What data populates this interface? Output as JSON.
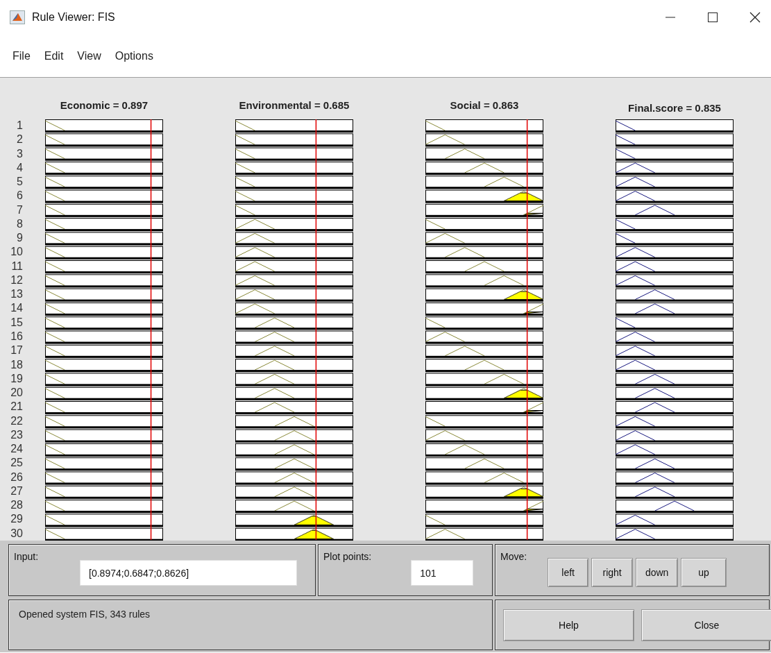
{
  "window": {
    "title": "Rule Viewer: FIS"
  },
  "menu": [
    "File",
    "Edit",
    "View",
    "Options"
  ],
  "columns": [
    {
      "title": "Economic = 0.897",
      "kind": "input"
    },
    {
      "title": "Environmental = 0.685",
      "kind": "input"
    },
    {
      "title": "Social = 0.863",
      "kind": "input"
    },
    {
      "title": "Final.score = 0.835",
      "kind": "output"
    }
  ],
  "rules": [
    "1",
    "2",
    "3",
    "4",
    "5",
    "6",
    "7",
    "8",
    "9",
    "10",
    "11",
    "12",
    "13",
    "14",
    "15",
    "16",
    "17",
    "18",
    "19",
    "20",
    "21",
    "22",
    "23",
    "24",
    "25",
    "26",
    "27",
    "28",
    "29",
    "30"
  ],
  "input": {
    "label": "Input:",
    "value": "[0.8974;0.6847;0.8626]"
  },
  "plot_points": {
    "label": "Plot points:",
    "value": "101"
  },
  "move": {
    "label": "Move:",
    "buttons": [
      "left",
      "right",
      "down",
      "up"
    ]
  },
  "status": "Opened system FIS, 343 rules",
  "buttons": [
    "Help",
    "Close"
  ]
}
